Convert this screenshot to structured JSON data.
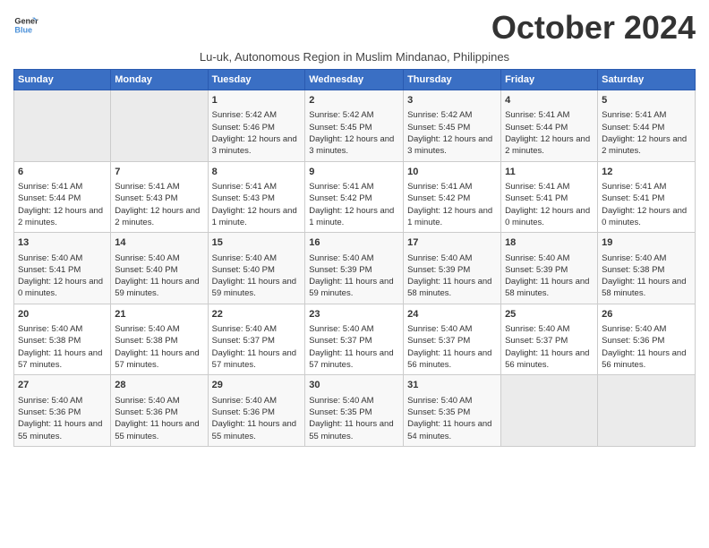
{
  "logo": {
    "line1": "General",
    "line2": "Blue"
  },
  "title": "October 2024",
  "subtitle": "Lu-uk, Autonomous Region in Muslim Mindanao, Philippines",
  "weekdays": [
    "Sunday",
    "Monday",
    "Tuesday",
    "Wednesday",
    "Thursday",
    "Friday",
    "Saturday"
  ],
  "weeks": [
    [
      {
        "day": "",
        "sunrise": "",
        "sunset": "",
        "daylight": ""
      },
      {
        "day": "",
        "sunrise": "",
        "sunset": "",
        "daylight": ""
      },
      {
        "day": "1",
        "sunrise": "Sunrise: 5:42 AM",
        "sunset": "Sunset: 5:46 PM",
        "daylight": "Daylight: 12 hours and 3 minutes."
      },
      {
        "day": "2",
        "sunrise": "Sunrise: 5:42 AM",
        "sunset": "Sunset: 5:45 PM",
        "daylight": "Daylight: 12 hours and 3 minutes."
      },
      {
        "day": "3",
        "sunrise": "Sunrise: 5:42 AM",
        "sunset": "Sunset: 5:45 PM",
        "daylight": "Daylight: 12 hours and 3 minutes."
      },
      {
        "day": "4",
        "sunrise": "Sunrise: 5:41 AM",
        "sunset": "Sunset: 5:44 PM",
        "daylight": "Daylight: 12 hours and 2 minutes."
      },
      {
        "day": "5",
        "sunrise": "Sunrise: 5:41 AM",
        "sunset": "Sunset: 5:44 PM",
        "daylight": "Daylight: 12 hours and 2 minutes."
      }
    ],
    [
      {
        "day": "6",
        "sunrise": "Sunrise: 5:41 AM",
        "sunset": "Sunset: 5:44 PM",
        "daylight": "Daylight: 12 hours and 2 minutes."
      },
      {
        "day": "7",
        "sunrise": "Sunrise: 5:41 AM",
        "sunset": "Sunset: 5:43 PM",
        "daylight": "Daylight: 12 hours and 2 minutes."
      },
      {
        "day": "8",
        "sunrise": "Sunrise: 5:41 AM",
        "sunset": "Sunset: 5:43 PM",
        "daylight": "Daylight: 12 hours and 1 minute."
      },
      {
        "day": "9",
        "sunrise": "Sunrise: 5:41 AM",
        "sunset": "Sunset: 5:42 PM",
        "daylight": "Daylight: 12 hours and 1 minute."
      },
      {
        "day": "10",
        "sunrise": "Sunrise: 5:41 AM",
        "sunset": "Sunset: 5:42 PM",
        "daylight": "Daylight: 12 hours and 1 minute."
      },
      {
        "day": "11",
        "sunrise": "Sunrise: 5:41 AM",
        "sunset": "Sunset: 5:41 PM",
        "daylight": "Daylight: 12 hours and 0 minutes."
      },
      {
        "day": "12",
        "sunrise": "Sunrise: 5:41 AM",
        "sunset": "Sunset: 5:41 PM",
        "daylight": "Daylight: 12 hours and 0 minutes."
      }
    ],
    [
      {
        "day": "13",
        "sunrise": "Sunrise: 5:40 AM",
        "sunset": "Sunset: 5:41 PM",
        "daylight": "Daylight: 12 hours and 0 minutes."
      },
      {
        "day": "14",
        "sunrise": "Sunrise: 5:40 AM",
        "sunset": "Sunset: 5:40 PM",
        "daylight": "Daylight: 11 hours and 59 minutes."
      },
      {
        "day": "15",
        "sunrise": "Sunrise: 5:40 AM",
        "sunset": "Sunset: 5:40 PM",
        "daylight": "Daylight: 11 hours and 59 minutes."
      },
      {
        "day": "16",
        "sunrise": "Sunrise: 5:40 AM",
        "sunset": "Sunset: 5:39 PM",
        "daylight": "Daylight: 11 hours and 59 minutes."
      },
      {
        "day": "17",
        "sunrise": "Sunrise: 5:40 AM",
        "sunset": "Sunset: 5:39 PM",
        "daylight": "Daylight: 11 hours and 58 minutes."
      },
      {
        "day": "18",
        "sunrise": "Sunrise: 5:40 AM",
        "sunset": "Sunset: 5:39 PM",
        "daylight": "Daylight: 11 hours and 58 minutes."
      },
      {
        "day": "19",
        "sunrise": "Sunrise: 5:40 AM",
        "sunset": "Sunset: 5:38 PM",
        "daylight": "Daylight: 11 hours and 58 minutes."
      }
    ],
    [
      {
        "day": "20",
        "sunrise": "Sunrise: 5:40 AM",
        "sunset": "Sunset: 5:38 PM",
        "daylight": "Daylight: 11 hours and 57 minutes."
      },
      {
        "day": "21",
        "sunrise": "Sunrise: 5:40 AM",
        "sunset": "Sunset: 5:38 PM",
        "daylight": "Daylight: 11 hours and 57 minutes."
      },
      {
        "day": "22",
        "sunrise": "Sunrise: 5:40 AM",
        "sunset": "Sunset: 5:37 PM",
        "daylight": "Daylight: 11 hours and 57 minutes."
      },
      {
        "day": "23",
        "sunrise": "Sunrise: 5:40 AM",
        "sunset": "Sunset: 5:37 PM",
        "daylight": "Daylight: 11 hours and 57 minutes."
      },
      {
        "day": "24",
        "sunrise": "Sunrise: 5:40 AM",
        "sunset": "Sunset: 5:37 PM",
        "daylight": "Daylight: 11 hours and 56 minutes."
      },
      {
        "day": "25",
        "sunrise": "Sunrise: 5:40 AM",
        "sunset": "Sunset: 5:37 PM",
        "daylight": "Daylight: 11 hours and 56 minutes."
      },
      {
        "day": "26",
        "sunrise": "Sunrise: 5:40 AM",
        "sunset": "Sunset: 5:36 PM",
        "daylight": "Daylight: 11 hours and 56 minutes."
      }
    ],
    [
      {
        "day": "27",
        "sunrise": "Sunrise: 5:40 AM",
        "sunset": "Sunset: 5:36 PM",
        "daylight": "Daylight: 11 hours and 55 minutes."
      },
      {
        "day": "28",
        "sunrise": "Sunrise: 5:40 AM",
        "sunset": "Sunset: 5:36 PM",
        "daylight": "Daylight: 11 hours and 55 minutes."
      },
      {
        "day": "29",
        "sunrise": "Sunrise: 5:40 AM",
        "sunset": "Sunset: 5:36 PM",
        "daylight": "Daylight: 11 hours and 55 minutes."
      },
      {
        "day": "30",
        "sunrise": "Sunrise: 5:40 AM",
        "sunset": "Sunset: 5:35 PM",
        "daylight": "Daylight: 11 hours and 55 minutes."
      },
      {
        "day": "31",
        "sunrise": "Sunrise: 5:40 AM",
        "sunset": "Sunset: 5:35 PM",
        "daylight": "Daylight: 11 hours and 54 minutes."
      },
      {
        "day": "",
        "sunrise": "",
        "sunset": "",
        "daylight": ""
      },
      {
        "day": "",
        "sunrise": "",
        "sunset": "",
        "daylight": ""
      }
    ]
  ]
}
